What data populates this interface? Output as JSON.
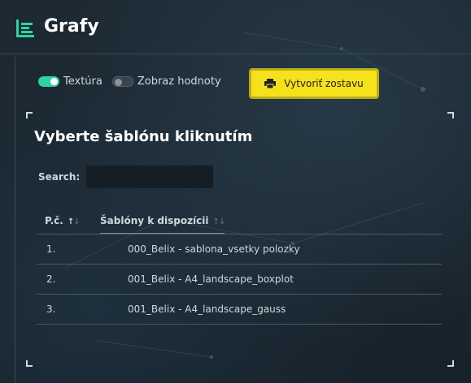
{
  "header": {
    "title": "Grafy",
    "icon": "chart-list-icon"
  },
  "toggles": [
    {
      "label": "Textúra",
      "state": "on"
    },
    {
      "label": "Zobraz hodnoty",
      "state": "off"
    }
  ],
  "report_button": {
    "label": "Vytvoriť zostavu",
    "icon": "printer-icon"
  },
  "card": {
    "title": "Vyberte šablónu kliknutím",
    "search_label": "Search:",
    "search_value": "",
    "columns": [
      "P.č.",
      "Šablóny k dispozícii"
    ],
    "rows": [
      {
        "num": "1.",
        "name": "000_Belix - sablona_vsetky polozky"
      },
      {
        "num": "2.",
        "name": "001_Belix - A4_landscape_boxplot"
      },
      {
        "num": "3.",
        "name": "001_Belix - A4_landscape_gauss"
      }
    ]
  },
  "colors": {
    "accent": "#f6e21c",
    "toggle_on": "#2fd3a0",
    "background": "#1a2630"
  }
}
